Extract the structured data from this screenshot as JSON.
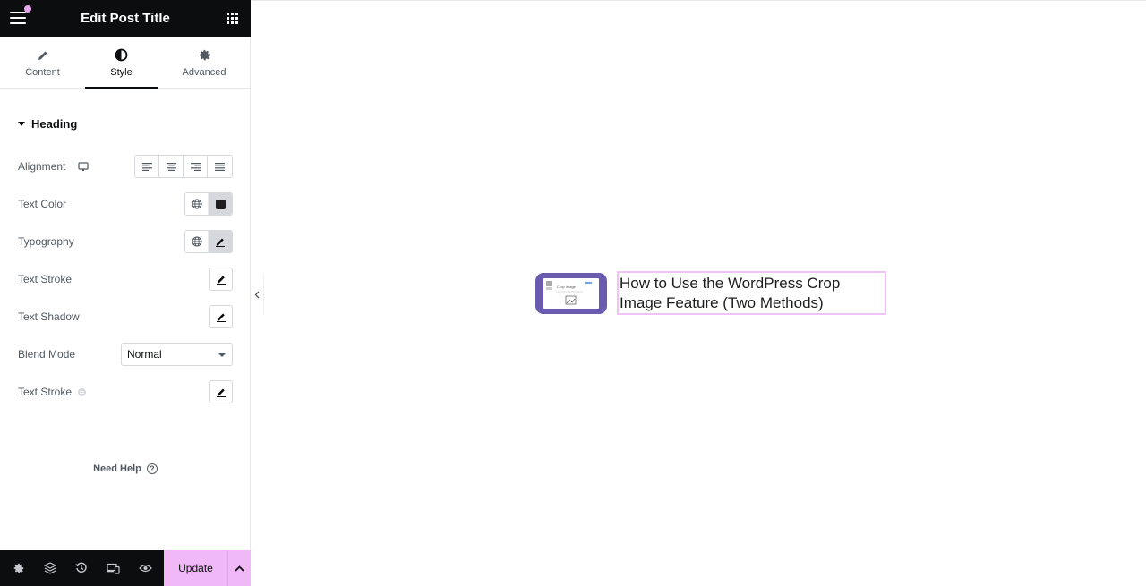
{
  "header": {
    "title": "Edit Post Title",
    "menu_icon": "hamburger-icon",
    "apps_icon": "apps-grid-icon"
  },
  "tabs": [
    {
      "label": "Content",
      "icon": "pencil-icon",
      "active": false
    },
    {
      "label": "Style",
      "icon": "half-circle-icon",
      "active": true
    },
    {
      "label": "Advanced",
      "icon": "gear-icon",
      "active": false
    }
  ],
  "section": {
    "title": "Heading",
    "expanded": true
  },
  "controls": {
    "alignment": {
      "label": "Alignment",
      "device_icon": "desktop-icon",
      "options": [
        "left",
        "center",
        "right",
        "justify"
      ]
    },
    "text_color": {
      "label": "Text Color",
      "swatch": "#1e1e1e"
    },
    "typography": {
      "label": "Typography"
    },
    "text_stroke": {
      "label": "Text Stroke"
    },
    "text_shadow": {
      "label": "Text Shadow"
    },
    "blend_mode": {
      "label": "Blend Mode",
      "value": "Normal"
    },
    "text_stroke_pro": {
      "label": "Text Stroke",
      "badge_icon": "pro-badge-icon"
    }
  },
  "help": {
    "label": "Need Help",
    "icon": "question-icon"
  },
  "footer": {
    "icons": [
      "settings-icon",
      "layers-icon",
      "history-icon",
      "responsive-icon",
      "preview-icon"
    ],
    "update_label": "Update",
    "more_icon": "chevron-up-icon"
  },
  "canvas": {
    "post_title": "How to Use the WordPress Crop Image Feature (Two Methods)",
    "thumbnail_caption": "Crop Image"
  },
  "colors": {
    "accent": "#f0b8f6",
    "dark": "#0c0d0e",
    "thumb_bg": "#6a5bb0",
    "notification_dot": "#e5a5f0"
  }
}
